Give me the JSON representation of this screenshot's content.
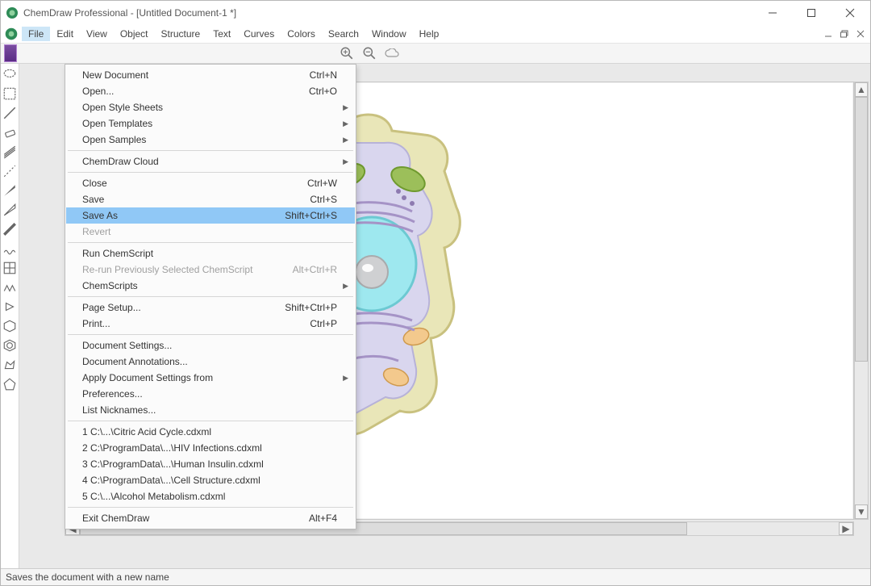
{
  "title": "ChemDraw Professional - [Untitled Document-1 *]",
  "menu": {
    "file": "File",
    "edit": "Edit",
    "view": "View",
    "object": "Object",
    "structure": "Structure",
    "text": "Text",
    "curves": "Curves",
    "colors": "Colors",
    "search": "Search",
    "window": "Window",
    "help": "Help"
  },
  "statusbar": "Saves the document with a new name",
  "dropdown": {
    "new": "New Document",
    "new_sc": "Ctrl+N",
    "open": "Open...",
    "open_sc": "Ctrl+O",
    "openstyles": "Open Style Sheets",
    "opentemplates": "Open Templates",
    "opensamples": "Open Samples",
    "cloud": "ChemDraw Cloud",
    "close": "Close",
    "close_sc": "Ctrl+W",
    "save": "Save",
    "save_sc": "Ctrl+S",
    "saveas": "Save As",
    "saveas_sc": "Shift+Ctrl+S",
    "revert": "Revert",
    "runcs": "Run ChemScript",
    "reruncs": "Re-run Previously Selected ChemScript",
    "reruncs_sc": "Alt+Ctrl+R",
    "chemscripts": "ChemScripts",
    "pagesetup": "Page Setup...",
    "pagesetup_sc": "Shift+Ctrl+P",
    "print": "Print...",
    "print_sc": "Ctrl+P",
    "docset": "Document Settings...",
    "docannot": "Document Annotations...",
    "applyset": "Apply Document Settings from",
    "prefs": "Preferences...",
    "listnick": "List Nicknames...",
    "r1": "1 C:\\...\\Citric Acid Cycle.cdxml",
    "r2": "2 C:\\ProgramData\\...\\HIV Infections.cdxml",
    "r3": "3 C:\\ProgramData\\...\\Human Insulin.cdxml",
    "r4": "4 C:\\ProgramData\\...\\Cell Structure.cdxml",
    "r5": "5 C:\\...\\Alcohol Metabolism.cdxml",
    "exit": "Exit ChemDraw",
    "exit_sc": "Alt+F4"
  }
}
